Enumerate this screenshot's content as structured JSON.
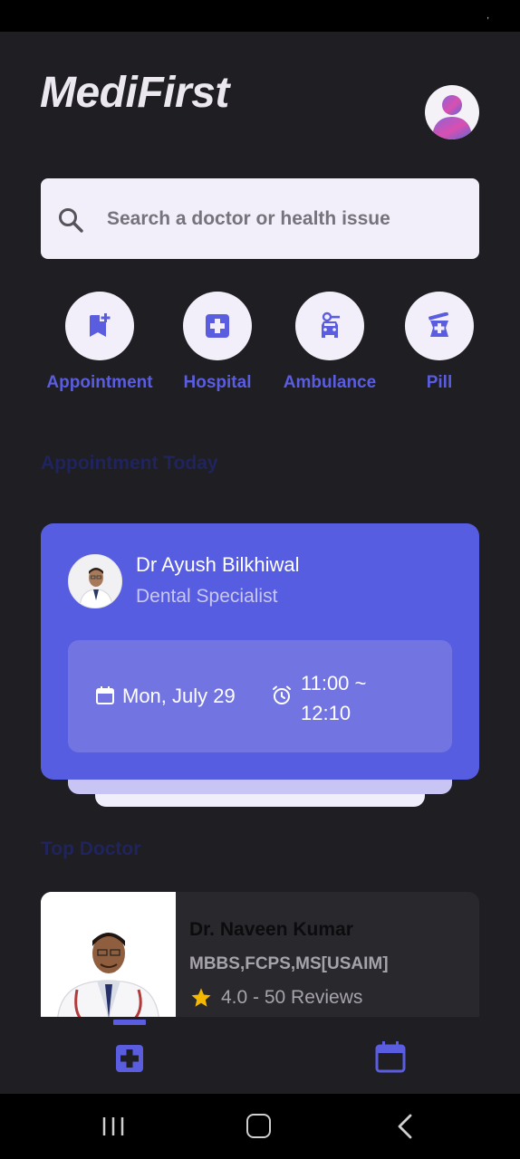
{
  "status_bar": {
    "mark": ","
  },
  "header": {
    "title": "MediFirst"
  },
  "search": {
    "placeholder": "Search a doctor or health issue"
  },
  "quick_actions": [
    {
      "label": "Appointment",
      "icon": "bookmark-add-icon"
    },
    {
      "label": "Hospital",
      "icon": "hospital-cross-icon"
    },
    {
      "label": "Ambulance",
      "icon": "ambulance-car-icon"
    },
    {
      "label": "Pill",
      "icon": "medicine-pill-icon"
    }
  ],
  "appointment_section": {
    "title": "Appointment Today",
    "doctor_name": "Dr Ayush Bilkhiwal",
    "specialty": "Dental Specialist",
    "date": "Mon, July 29",
    "time": "11:00 ~ 12:10"
  },
  "top_doctor_section": {
    "title": "Top Doctor",
    "doctors": [
      {
        "name": "Dr. Naveen Kumar",
        "qualifications": "MBBS,FCPS,MS[USAIM]",
        "rating_text": "4.0 - 50 Reviews"
      }
    ]
  },
  "bottom_nav": {
    "active": "home",
    "items": [
      "home-cross-icon",
      "calendar-icon"
    ]
  },
  "colors": {
    "accent": "#5a5de0",
    "card": "#575de1",
    "background": "#1f1e22",
    "star": "#f5b800"
  }
}
